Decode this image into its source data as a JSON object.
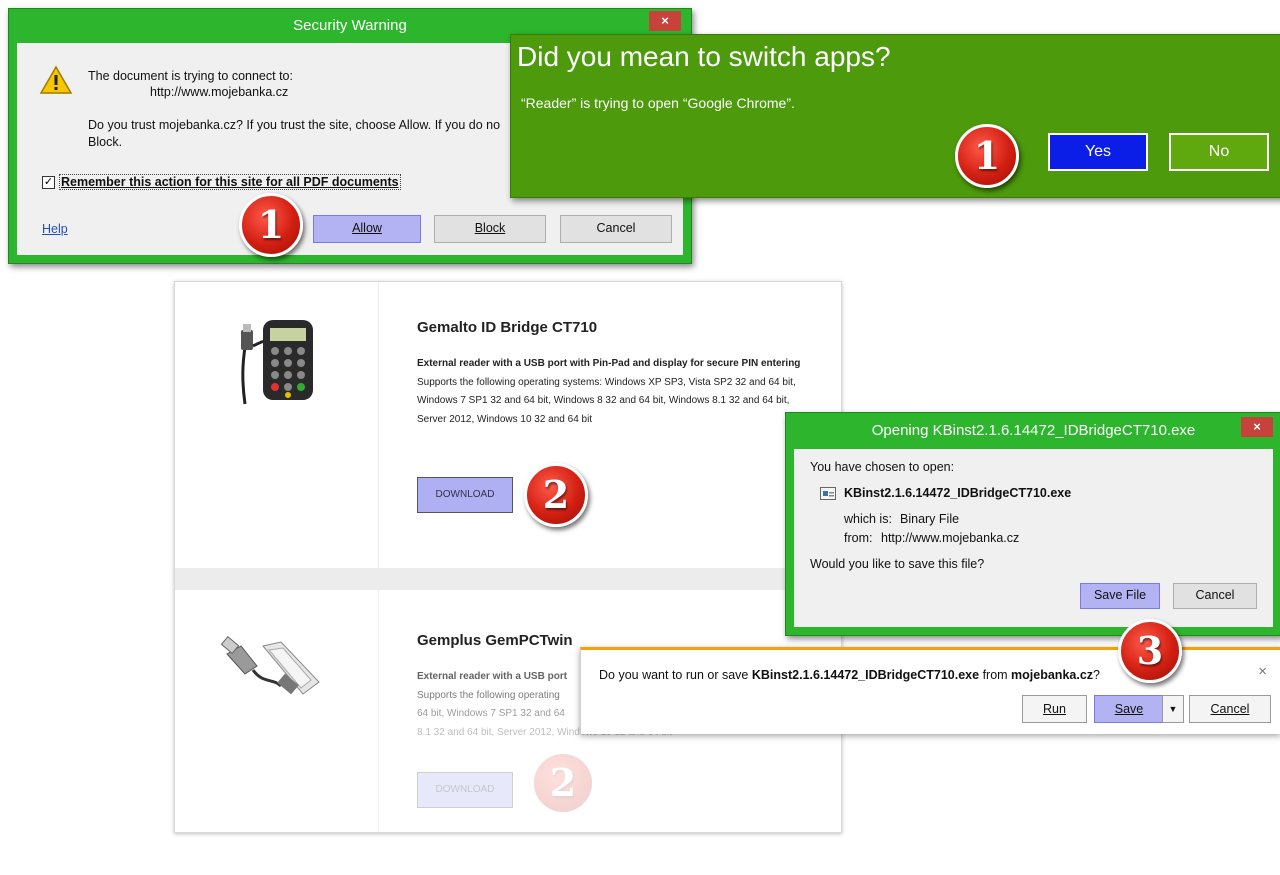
{
  "security_warning": {
    "title": "Security Warning",
    "close": "×",
    "line1": "The document is trying to connect to:",
    "url": "http://www.mojebanka.cz",
    "trust_text": "Do you trust mojebanka.cz? If you trust the site, choose Allow. If you do no",
    "trust_text2": "Block.",
    "remember_label": "Remember this action for this site for all PDF documents",
    "remember_checked": "✓",
    "help": "Help",
    "allow": "Allow",
    "block": "Block",
    "cancel": "Cancel"
  },
  "switch_apps": {
    "title": "Did you mean to switch apps?",
    "subtitle": "“Reader” is trying to open “Google Chrome”.",
    "yes": "Yes",
    "no": "No"
  },
  "download_page": {
    "product1": {
      "title": "Gemalto ID Bridge CT710",
      "desc_bold": "External reader with a USB port with Pin-Pad and display for secure PIN entering",
      "desc": "Supports the following operating systems: Windows XP SP3, Vista SP2 32 and 64 bit, Windows 7 SP1 32 and 64 bit, Windows 8 32 and 64 bit, Windows 8.1 32 and 64 bit, Server 2012, Windows 10 32 and 64 bit",
      "download": "DOWNLOAD"
    },
    "product2": {
      "title": "Gemplus GemPCTwin",
      "desc_bold": "External reader with a USB port",
      "desc_l1": "Supports the following operating",
      "desc_l2": "64 bit, Windows 7 SP1 32 and 64",
      "desc_l3": "8.1 32 and 64 bit, Server 2012, Windows 10 32 and 64 bit",
      "download": "DOWNLOAD"
    }
  },
  "opening_dialog": {
    "title": "Opening KBinst2.1.6.14472_IDBridgeCT710.exe",
    "close": "×",
    "chosen": "You have chosen to open:",
    "filename": "KBinst2.1.6.14472_IDBridgeCT710.exe",
    "which_is_label": "which is:",
    "which_is_value": "Binary File",
    "from_label": "from:",
    "from_value": "http://www.mojebanka.cz",
    "question": "Would you like to save this file?",
    "save_file": "Save File",
    "cancel": "Cancel"
  },
  "ie_bar": {
    "text_pre": "Do you want to run or save",
    "filename": "KBinst2.1.6.14472_IDBridgeCT710.exe",
    "text_mid": "from",
    "site": "mojebanka.cz",
    "text_post": "?",
    "close": "×",
    "run": "Run",
    "save": "Save",
    "cancel": "Cancel",
    "dropdown": "▼"
  },
  "badges": {
    "step1": "1",
    "step2": "2",
    "step3": "3"
  },
  "colors": {
    "dialog_green": "#2db52d",
    "metro_green": "#4d9a0d",
    "metro_yes": "#0a1ee8",
    "metro_no": "#5fa80e",
    "badge_red": "#d21f12",
    "ie_accent": "#f1a30f"
  }
}
